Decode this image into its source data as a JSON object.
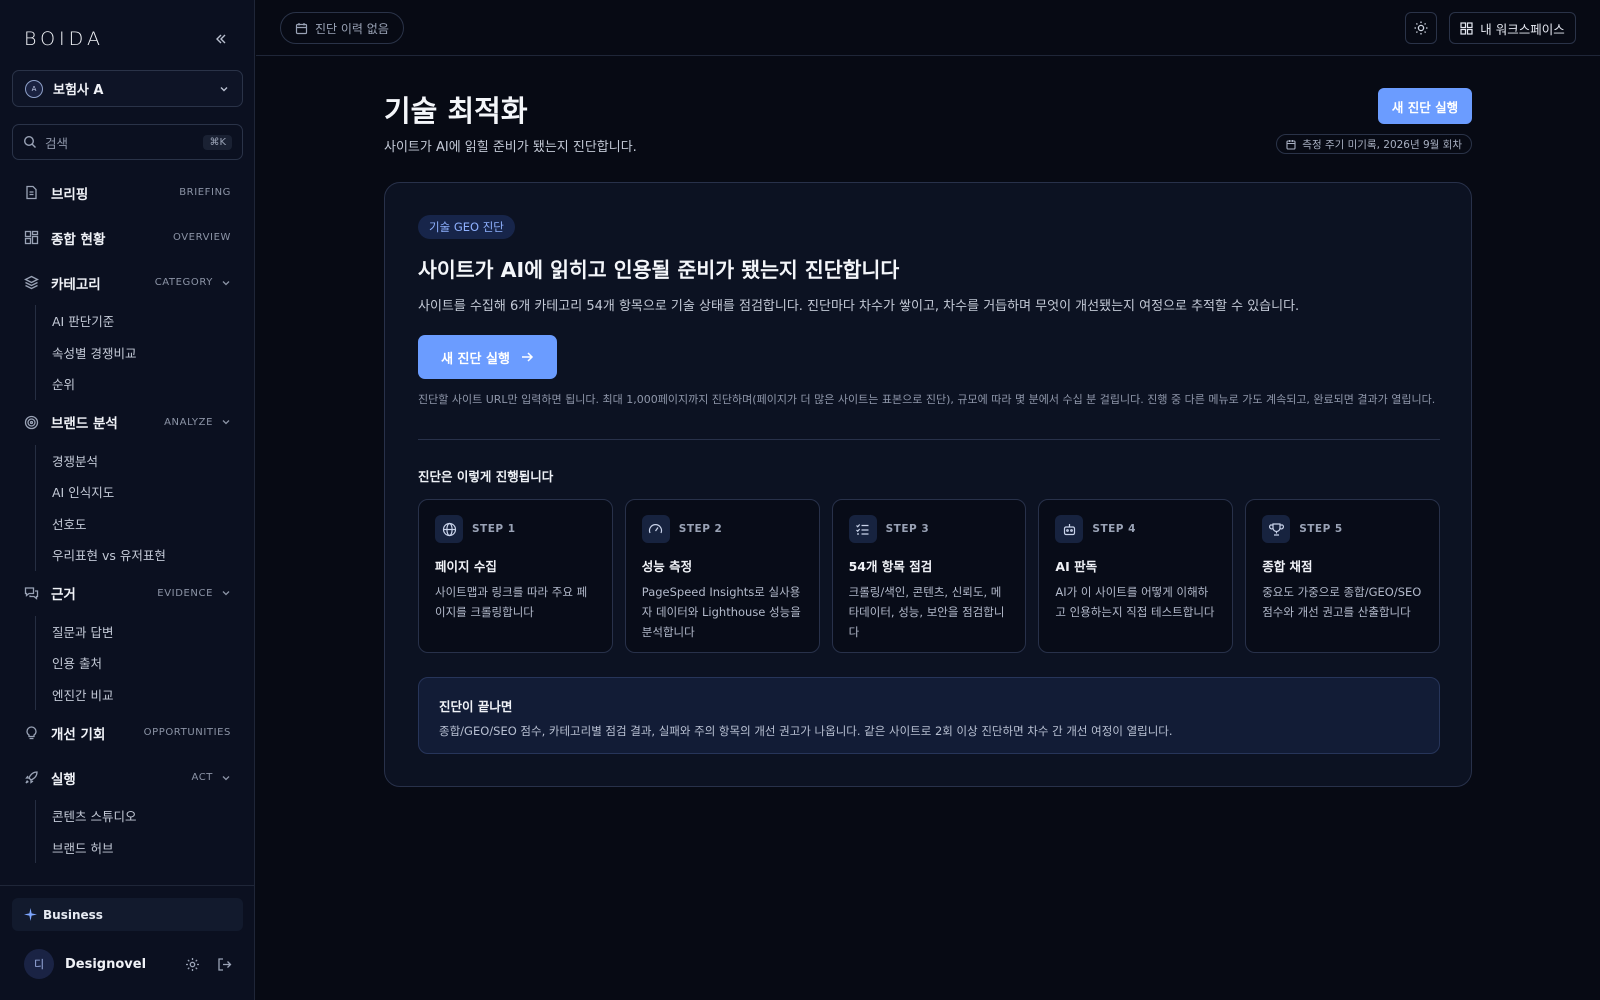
{
  "sidebar": {
    "logo": "BOIDA",
    "org": {
      "avatar": "A",
      "name": "보험사 A"
    },
    "search": {
      "placeholder": "검색",
      "shortcut": "⌘K"
    },
    "nav": [
      {
        "label": "브리핑",
        "en": "BRIEFING",
        "icon": "document-icon",
        "sub": []
      },
      {
        "label": "종합 현황",
        "en": "OVERVIEW",
        "icon": "grid-icon",
        "sub": []
      },
      {
        "label": "카테고리",
        "en": "CATEGORY",
        "icon": "layers-icon",
        "sub": [
          "AI 판단기준",
          "속성별 경쟁비교",
          "순위"
        ]
      },
      {
        "label": "브랜드 분석",
        "en": "ANALYZE",
        "icon": "target-icon",
        "sub": [
          "경쟁분석",
          "AI 인식지도",
          "선호도",
          "우리표현 vs 유저표현"
        ]
      },
      {
        "label": "근거",
        "en": "EVIDENCE",
        "icon": "chat-icon",
        "sub": [
          "질문과 답변",
          "인용 출처",
          "엔진간 비교"
        ]
      },
      {
        "label": "개선 기회",
        "en": "OPPORTUNITIES",
        "icon": "lightbulb-icon",
        "sub": []
      },
      {
        "label": "실행",
        "en": "ACT",
        "icon": "rocket-icon",
        "sub": [
          "콘텐츠 스튜디오",
          "브랜드 허브"
        ]
      }
    ],
    "plan": "Business",
    "user": {
      "avatar": "디",
      "name": "Designovel"
    }
  },
  "topbar": {
    "history": "진단 이력 없음",
    "workspace": "내 워크스페이스"
  },
  "header": {
    "title": "기술 최적화",
    "subtitle": "사이트가 AI에 읽힐 준비가 됐는지 진단합니다.",
    "run_button": "새 진단 실행",
    "cycle": "측정 주기 미기록, 2026년 9월 회차"
  },
  "card": {
    "tag": "기술 GEO 진단",
    "title": "사이트가 AI에 읽히고 인용될 준비가 됐는지 진단합니다",
    "desc": "사이트를 수집해 6개 카테고리 54개 항목으로 기술 상태를 점검합니다. 진단마다 차수가 쌓이고, 차수를 거듭하며 무엇이 개선됐는지 여정으로 추적할 수 있습니다.",
    "run_button": "새 진단 실행",
    "note": "진단할 사이트 URL만 입력하면 됩니다. 최대 1,000페이지까지 진단하며(페이지가 더 많은 사이트는 표본으로 진단), 규모에 따라 몇 분에서 수십 분 걸립니다. 진행 중 다른 메뉴로 가도 계속되고, 완료되면 결과가 열립니다.",
    "steps_heading": "진단은 이렇게 진행됩니다",
    "steps": [
      {
        "num": "STEP 1",
        "title": "페이지 수집",
        "desc": "사이트맵과 링크를 따라 주요 페이지를 크롤링합니다",
        "icon": "globe-icon"
      },
      {
        "num": "STEP 2",
        "title": "성능 측정",
        "desc": "PageSpeed Insights로 실사용자 데이터와 Lighthouse 성능을 분석합니다",
        "icon": "gauge-icon"
      },
      {
        "num": "STEP 3",
        "title": "54개 항목 점검",
        "desc": "크롤링/색인, 콘텐츠, 신뢰도, 메타데이터, 성능, 보안을 점검합니다",
        "icon": "checklist-icon"
      },
      {
        "num": "STEP 4",
        "title": "AI 판독",
        "desc": "AI가 이 사이트를 어떻게 이해하고 인용하는지 직접 테스트합니다",
        "icon": "robot-icon"
      },
      {
        "num": "STEP 5",
        "title": "종합 채점",
        "desc": "중요도 가중으로 종합/GEO/SEO 점수와 개선 권고를 산출합니다",
        "icon": "trophy-icon"
      }
    ],
    "after": {
      "title": "진단이 끝나면",
      "desc": "종합/GEO/SEO 점수, 카테고리별 점검 결과, 실패와 주의 항목의 개선 권고가 나옵니다. 같은 사이트로 2회 이상 진단하면 차수 간 개선 여정이 열립니다."
    }
  },
  "colors": {
    "accent": "#6b9cff",
    "background": "#070a14",
    "sidebar": "#0b1020"
  }
}
